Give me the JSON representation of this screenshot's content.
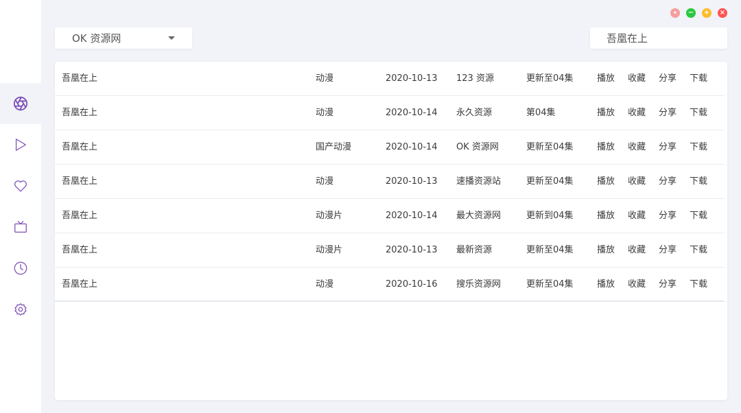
{
  "colors": {
    "accent": "#7e50b8",
    "background": "#f1f3f8",
    "panel": "#ffffff",
    "win_pin": "#f59f9f",
    "win_min": "#2bc840",
    "win_max": "#fdbc2c",
    "win_close": "#fd5451"
  },
  "sidebar": {
    "items": [
      {
        "icon": "aperture-icon",
        "active": true
      },
      {
        "icon": "play-icon",
        "active": false
      },
      {
        "icon": "heart-icon",
        "active": false
      },
      {
        "icon": "tv-icon",
        "active": false
      },
      {
        "icon": "clock-icon",
        "active": false
      },
      {
        "icon": "gear-icon",
        "active": false
      }
    ]
  },
  "window_controls": [
    {
      "icon": "pin-icon",
      "symbol": "✦"
    },
    {
      "icon": "minimize-icon",
      "symbol": "−"
    },
    {
      "icon": "maximize-icon",
      "symbol": "+"
    },
    {
      "icon": "close-icon",
      "symbol": "×"
    }
  ],
  "site_select": {
    "value": "OK 资源网",
    "icon": "caret-down-icon"
  },
  "search": {
    "value": "吾凰在上"
  },
  "table": {
    "actions": {
      "play": "播放",
      "favorite": "收藏",
      "share": "分享",
      "download": "下载"
    },
    "rows": [
      {
        "name": "吾凰在上",
        "type": "动漫",
        "date": "2020-10-13",
        "site": "123 资源",
        "note": "更新至04集"
      },
      {
        "name": "吾凰在上",
        "type": "动漫",
        "date": "2020-10-14",
        "site": "永久资源",
        "note": "第04集"
      },
      {
        "name": "吾凰在上",
        "type": "国产动漫",
        "date": "2020-10-14",
        "site": "OK 资源网",
        "note": "更新至04集"
      },
      {
        "name": "吾凰在上",
        "type": "动漫",
        "date": "2020-10-13",
        "site": "速播资源站",
        "note": "更新至04集"
      },
      {
        "name": "吾凰在上",
        "type": "动漫片",
        "date": "2020-10-14",
        "site": "最大资源网",
        "note": "更新到04集"
      },
      {
        "name": "吾凰在上",
        "type": "动漫片",
        "date": "2020-10-13",
        "site": "最新资源",
        "note": "更新至04集"
      },
      {
        "name": "吾凰在上",
        "type": "动漫",
        "date": "2020-10-16",
        "site": "搜乐资源网",
        "note": "更新至04集"
      }
    ]
  }
}
